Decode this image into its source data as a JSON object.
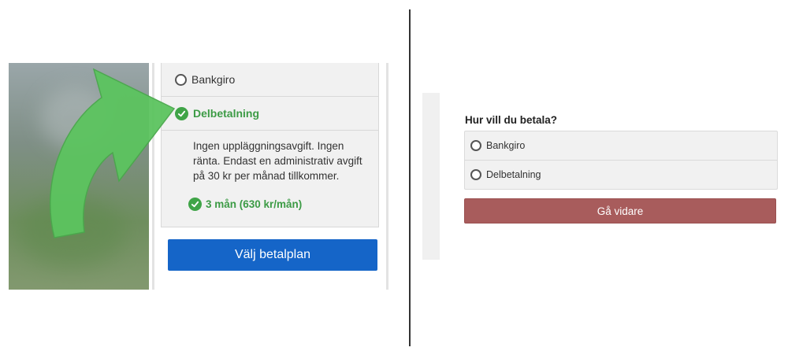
{
  "left": {
    "options": [
      {
        "label": "Bankgiro",
        "selected": false
      },
      {
        "label": "Delbetalning",
        "selected": true
      }
    ],
    "description": "Ingen uppläggningsavgift. Ingen ränta. Endast en administrativ avgift på 30 kr per månad tillkommer.",
    "plan_label": "3 mån (630 kr/mån)",
    "button_label": "Välj betalplan",
    "colors": {
      "accent_green": "#3c9b45",
      "button_blue": "#1565c8",
      "arrow_green": "#5cc45f"
    }
  },
  "right": {
    "question": "Hur vill du betala?",
    "options": [
      {
        "label": "Bankgiro",
        "selected": false
      },
      {
        "label": "Delbetalning",
        "selected": false
      }
    ],
    "button_label": "Gå vidare",
    "colors": {
      "button": "#a85c5c"
    }
  },
  "icons": {
    "radio": "radio-empty-icon",
    "check": "check-circle-icon",
    "arrow": "curved-arrow-icon"
  }
}
